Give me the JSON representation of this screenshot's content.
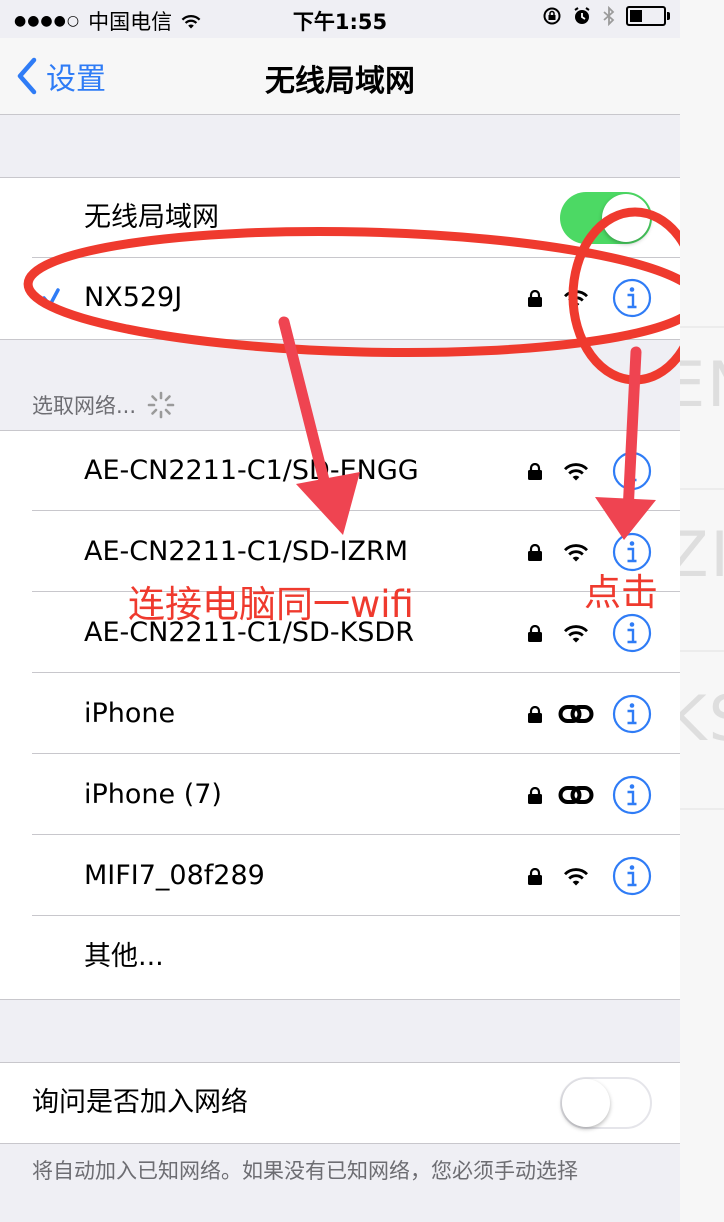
{
  "status_bar": {
    "signal_dots": "●●●●○",
    "carrier": "中国电信",
    "time": "下午1:55"
  },
  "nav": {
    "back_label": "设置",
    "title": "无线局域网"
  },
  "wifi_toggle": {
    "label": "无线局域网",
    "on": true,
    "on_color": "#4cd964"
  },
  "connected_network": {
    "name": "NX529J",
    "locked": true,
    "signal_icon": "wifi-icon"
  },
  "choose_network": {
    "header": "选取网络...",
    "networks": [
      {
        "name": "AE-CN2211-C1/SD-ENGG",
        "signal_icon": "wifi-icon"
      },
      {
        "name": "AE-CN2211-C1/SD-IZRM",
        "signal_icon": "wifi-icon"
      },
      {
        "name": "AE-CN2211-C1/SD-KSDR",
        "signal_icon": "wifi-icon"
      },
      {
        "name": "iPhone",
        "signal_icon": "hotspot-link-icon"
      },
      {
        "name": "iPhone (7)",
        "signal_icon": "hotspot-link-icon"
      },
      {
        "name": "MIFI7_08f289",
        "signal_icon": "wifi-icon"
      }
    ],
    "other_label": "其他..."
  },
  "ask_to_join": {
    "label": "询问是否加入网络",
    "on": false
  },
  "footer_note": "将自动加入已知网络。如果没有已知网络，您必须手动选择",
  "annotations": {
    "left_text": "连接电脑同一wifi",
    "right_text": "点击",
    "color": "#ef3a2e"
  },
  "accent_color": "#2f7cf6"
}
